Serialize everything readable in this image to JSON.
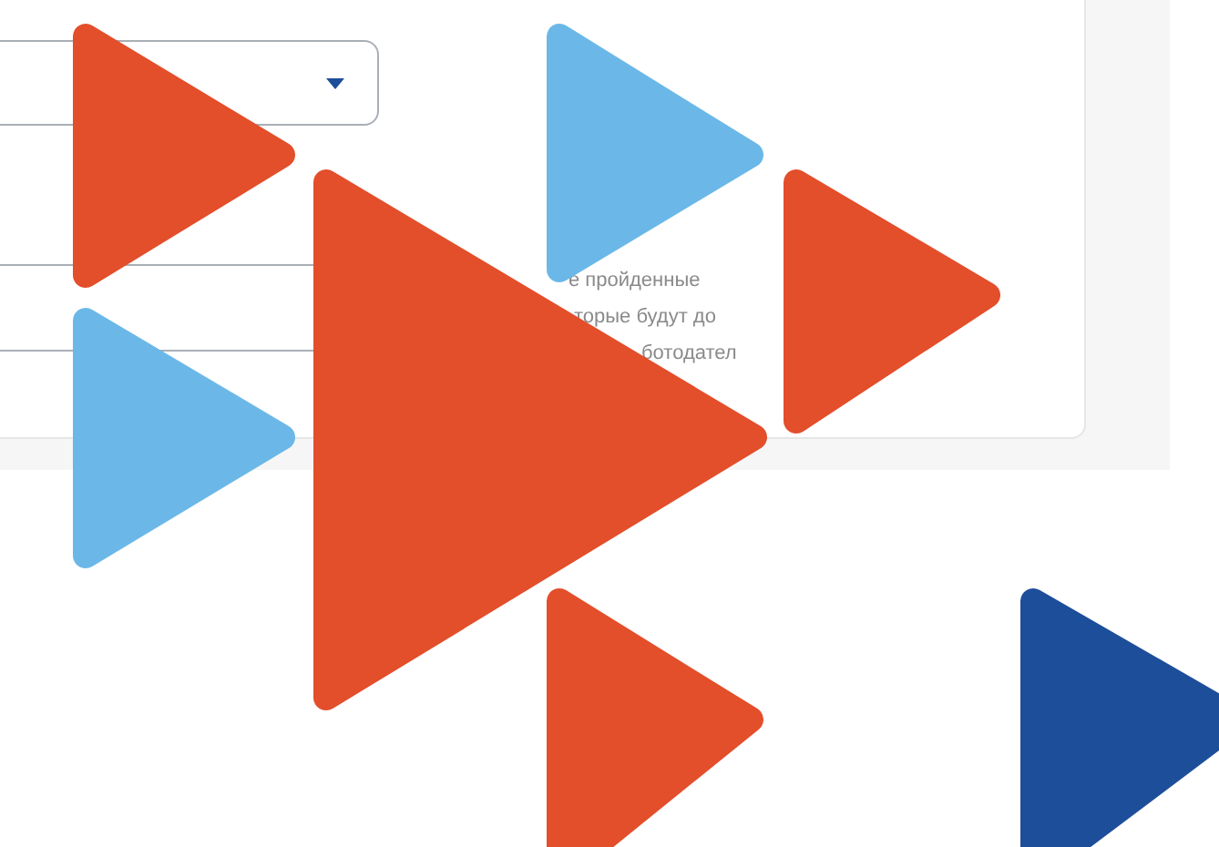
{
  "card": {
    "hint_lines": [
      "е пройденные",
      "торые будут до",
      "ботодател"
    ]
  }
}
